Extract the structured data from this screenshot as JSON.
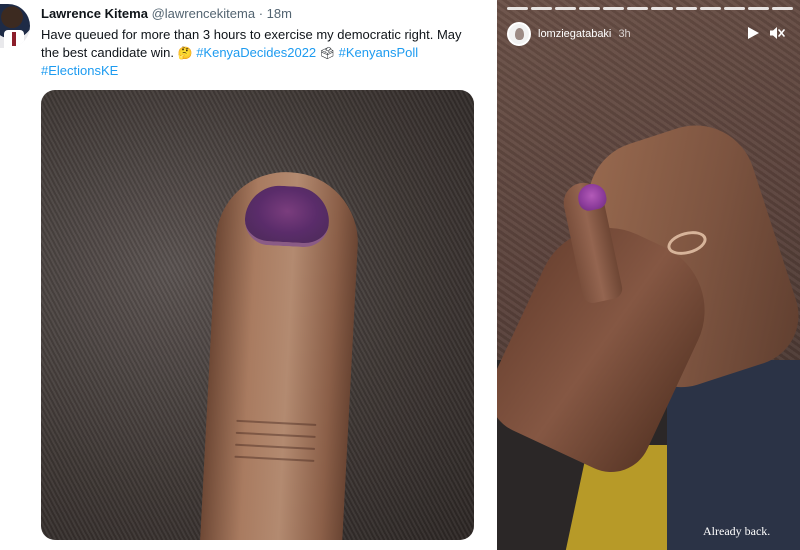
{
  "tweet": {
    "author_name": "Lawrence Kitema",
    "handle": "@lawrencekitema",
    "separator": "·",
    "time": "18m",
    "text_part1": "Have queued for more than 3 hours to exercise my democratic right. May the best candidate win.",
    "emoji1": "🤔",
    "hashtag1": "#KenyaDecides2022",
    "emoji2": "🗳",
    "hashtag2": "#KenyansPoll",
    "hashtag3": "#ElectionsKE",
    "link_color": "#1d9bf0"
  },
  "story": {
    "username": "lomziegatabaki",
    "time": "3h",
    "caption": "Already back.",
    "progress_segments": 12,
    "icons": [
      "play-icon",
      "mute-icon"
    ]
  }
}
